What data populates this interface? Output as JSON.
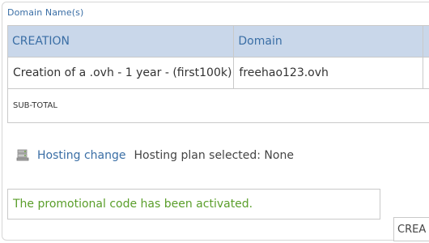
{
  "section": {
    "title": "Domain Name(s)"
  },
  "table": {
    "headers": [
      "CREATION",
      "Domain",
      ""
    ],
    "rows": [
      {
        "creation": "Creation of a .ovh - 1 year - (first100k)",
        "domain": "freehao123.ovh"
      }
    ],
    "subtotal_label": "SUB-TOTAL"
  },
  "hosting": {
    "icon": "server-icon",
    "link_label": "Hosting change",
    "status_label": "Hosting plan selected: None"
  },
  "promo": {
    "message": "The promotional code has been activated."
  },
  "action": {
    "create_label": "CREA"
  },
  "colors": {
    "accent": "#3a6ea5",
    "header_bg": "#c9d7ea",
    "success": "#5a9e2a"
  }
}
